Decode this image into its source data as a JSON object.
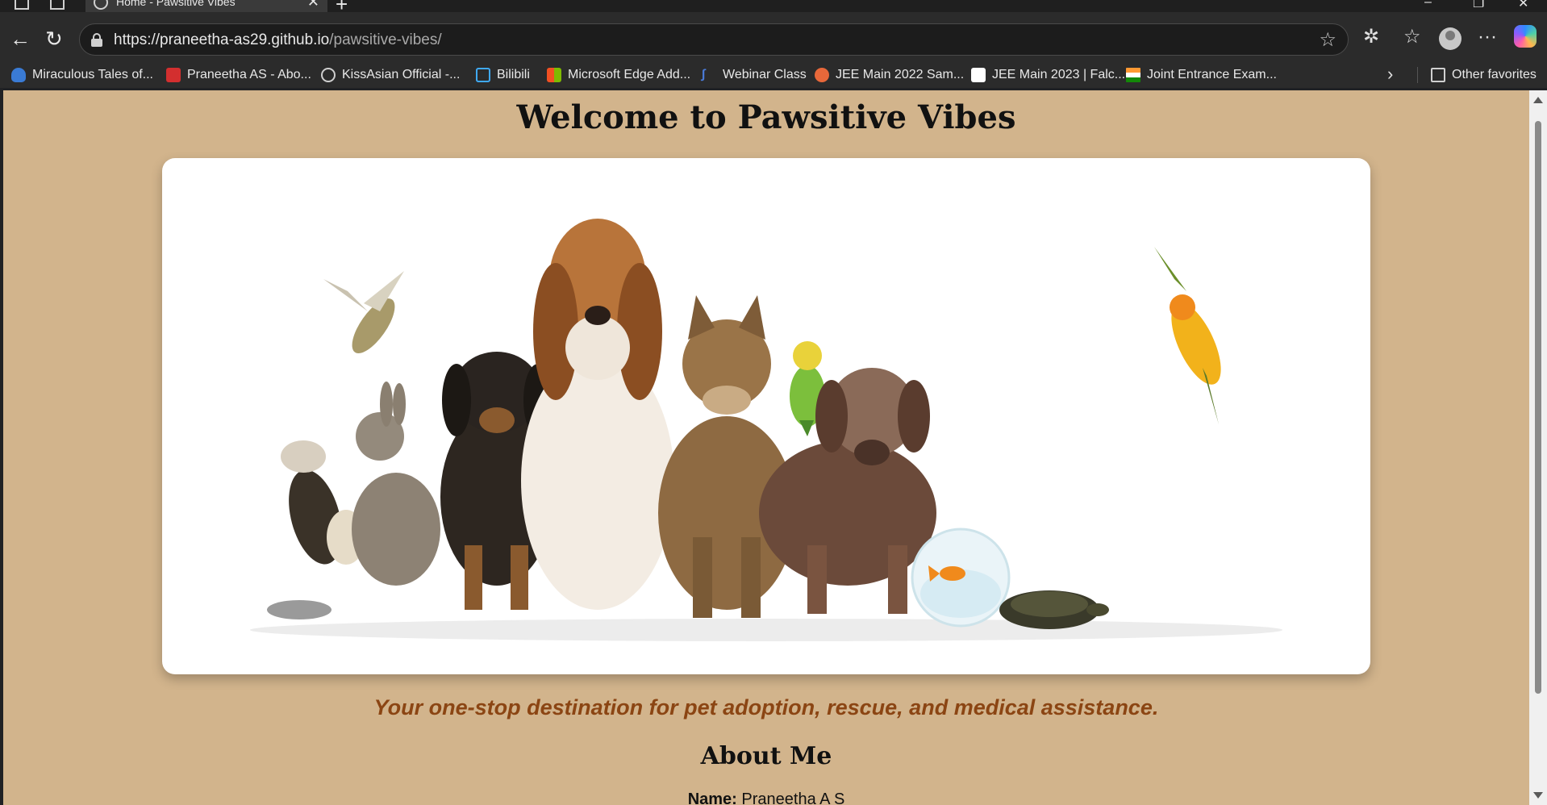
{
  "browser": {
    "tab_title": "Home - Pawsitive Vibes",
    "url_host": "https://praneetha-as29.github.io",
    "url_path": "/pawsitive-vibes/",
    "favorites": [
      {
        "label": "Miraculous Tales of...",
        "icon": "mask-icon",
        "color": "#3a7bd5"
      },
      {
        "label": "Praneetha AS - Abo...",
        "icon": "folder-icon",
        "color": "#d32f2f"
      },
      {
        "label": "KissAsian Official -...",
        "icon": "globe-icon",
        "color": "#cfcfcf"
      },
      {
        "label": "Bilibili",
        "icon": "tv-icon",
        "color": "#3fa9f5"
      },
      {
        "label": "Microsoft Edge Add...",
        "icon": "windows-logo-icon",
        "color": "#f25022"
      },
      {
        "label": "Webinar Class",
        "icon": "pen-icon",
        "color": "#4a7bd8"
      },
      {
        "label": "JEE Main 2022 Sam...",
        "icon": "v-badge-icon",
        "color": "#e8683a"
      },
      {
        "label": "JEE Main 2023 | Falc...",
        "icon": "document-icon",
        "color": "#ffffff"
      },
      {
        "label": "Joint Entrance Exam...",
        "icon": "india-flag-icon",
        "color": "#ff9933"
      }
    ],
    "other_favorites": "Other favorites"
  },
  "page": {
    "title": "Welcome to Pawsitive Vibes",
    "tagline": "Your one-stop destination for pet adoption, rescue, and medical assistance.",
    "about_title": "About Me",
    "about_name_label": "Name:",
    "about_name_value": "Praneetha A S"
  },
  "colors": {
    "page_background": "#d2b48c",
    "tagline": "#8b4513"
  }
}
